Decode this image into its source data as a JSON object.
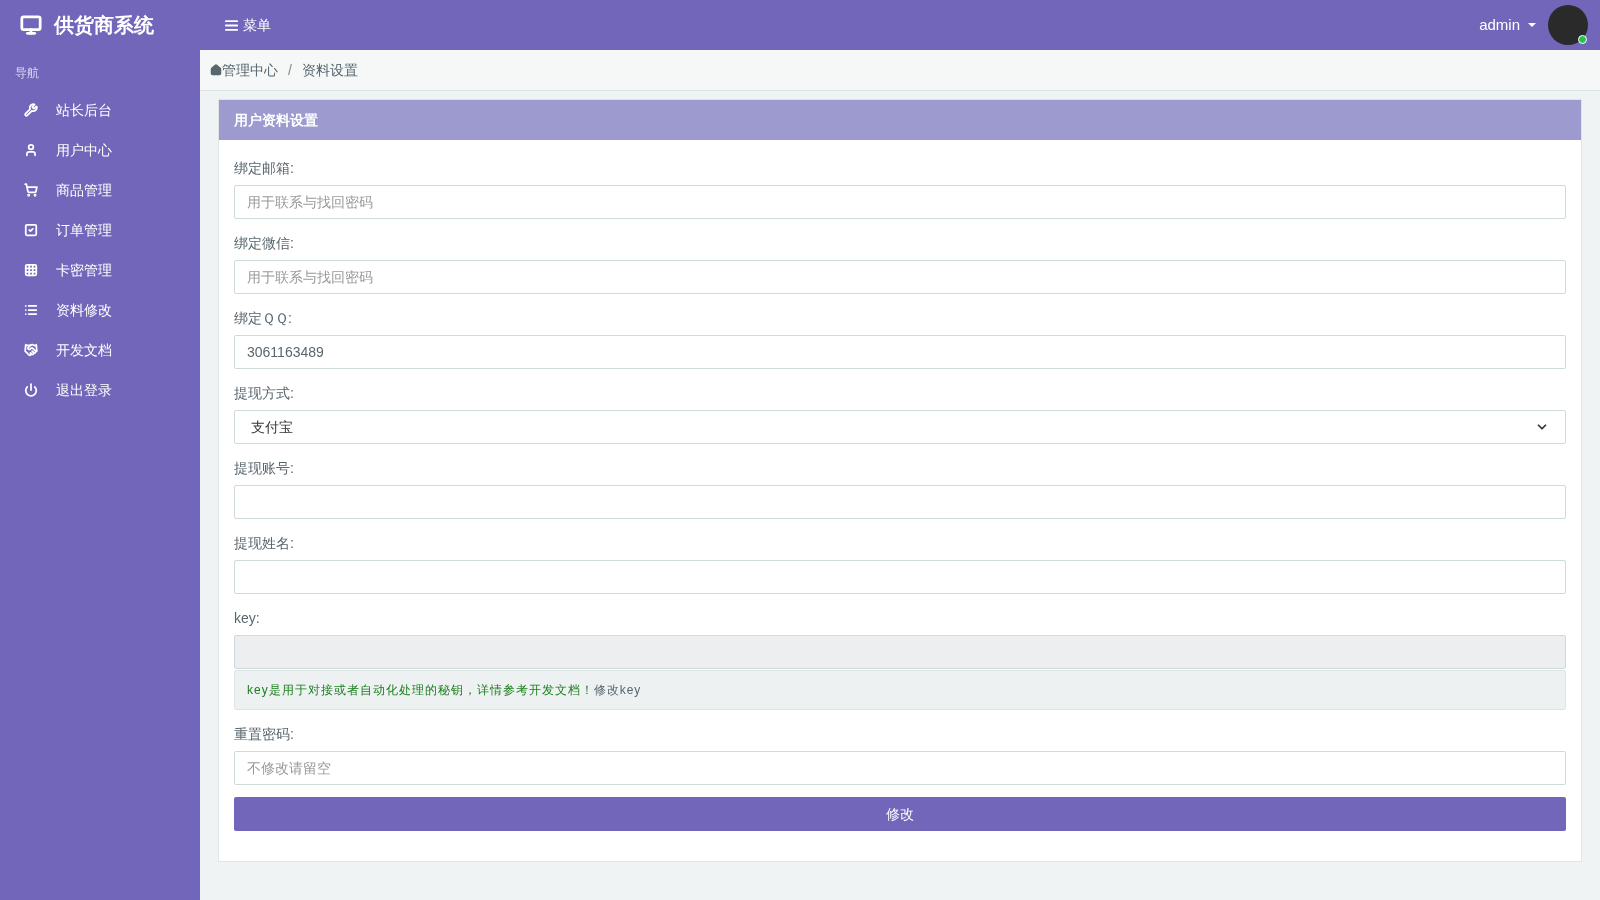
{
  "header": {
    "logo": "供货商系统",
    "menu_toggle": "菜单",
    "user": "admin",
    "online": true
  },
  "sidebar": {
    "heading": "导航",
    "items": [
      {
        "label": "站长后台"
      },
      {
        "label": "用户中心"
      },
      {
        "label": "商品管理"
      },
      {
        "label": "订单管理"
      },
      {
        "label": "卡密管理"
      },
      {
        "label": "资料修改"
      },
      {
        "label": "开发文档"
      },
      {
        "label": "退出登录"
      }
    ]
  },
  "breadcrumb": {
    "items": [
      "管理中心",
      "资料设置"
    ],
    "separator": "/"
  },
  "panel": {
    "title": "用户资料设置",
    "fields": [
      {
        "kind": "input",
        "label": "绑定邮箱:",
        "placeholder": "用于联系与找回密码"
      },
      {
        "kind": "input",
        "label": "绑定微信:",
        "placeholder": "用于联系与找回密码"
      },
      {
        "kind": "input",
        "label": "绑定ＱＱ:",
        "value": "3061163489"
      },
      {
        "kind": "select",
        "label": "提现方式:",
        "value": "支付宝"
      },
      {
        "kind": "input",
        "label": "提现账号:"
      },
      {
        "kind": "input",
        "label": "提现姓名:"
      },
      {
        "kind": "key",
        "label": "key:",
        "disabled": true,
        "note": "key是用于对接或者自动化处理的秘钥，详情参考开发文档！",
        "link": "修改key"
      },
      {
        "kind": "input",
        "label": "重置密码:",
        "placeholder": "不修改请留空"
      }
    ],
    "submit": "修改"
  }
}
